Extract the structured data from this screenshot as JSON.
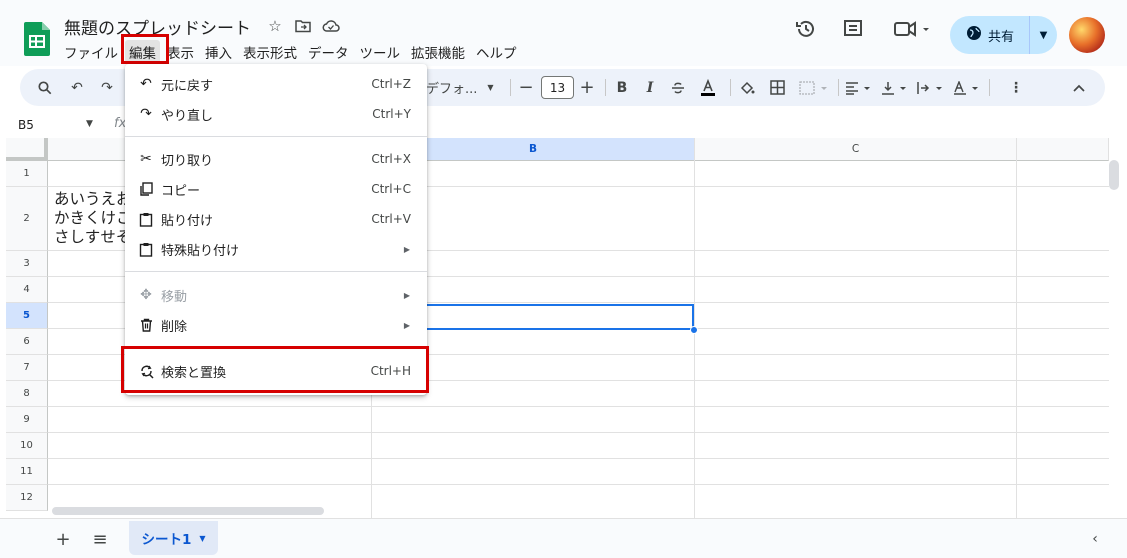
{
  "header": {
    "doc_title": "無題のスプレッドシート",
    "title_icons": [
      "star-icon",
      "move-folder-icon",
      "cloud-status-icon"
    ],
    "menus": [
      "ファイル",
      "編集",
      "表示",
      "挿入",
      "表示形式",
      "データ",
      "ツール",
      "拡張機能",
      "ヘルプ"
    ],
    "active_menu": "編集",
    "right_icons": [
      "history-icon",
      "comment-icon",
      "meet-icon"
    ],
    "share_label": "共有"
  },
  "toolbar": {
    "font_name": "デフォ...",
    "font_size": "13",
    "bold": "B",
    "italic": "I"
  },
  "formula_bar": {
    "cell_ref": "B5",
    "fx": "fx"
  },
  "grid": {
    "columns": [
      "B",
      "C"
    ],
    "selected_column": "B",
    "rows": [
      "1",
      "2",
      "3",
      "4",
      "5",
      "6",
      "7",
      "8",
      "9",
      "10",
      "11",
      "12"
    ],
    "selected_row": "5",
    "a2_text": "あいうえお\nかきくけこ\nさしすせそ"
  },
  "edit_menu": {
    "items": [
      {
        "icon": "undo-icon",
        "label": "元に戻す",
        "shortcut": "Ctrl+Z"
      },
      {
        "icon": "redo-icon",
        "label": "やり直し",
        "shortcut": "Ctrl+Y"
      },
      {
        "icon": "cut-icon",
        "label": "切り取り",
        "shortcut": "Ctrl+X"
      },
      {
        "icon": "copy-icon",
        "label": "コピー",
        "shortcut": "Ctrl+C"
      },
      {
        "icon": "paste-icon",
        "label": "貼り付け",
        "shortcut": "Ctrl+V"
      },
      {
        "icon": "paste-special-icon",
        "label": "特殊貼り付け",
        "submenu": true
      },
      {
        "icon": "move-icon",
        "label": "移動",
        "submenu": true,
        "disabled": true
      },
      {
        "icon": "delete-icon",
        "label": "削除",
        "submenu": true
      },
      {
        "icon": "find-replace-icon",
        "label": "検索と置換",
        "shortcut": "Ctrl+H",
        "highlighted": true
      }
    ]
  },
  "bottom_bar": {
    "sheet_tab": "シート1"
  },
  "colors": {
    "accent": "#1a73e8",
    "highlight": "#d60000",
    "share_bg": "#c2e7ff",
    "sheet_logo": "#0f9d58"
  }
}
